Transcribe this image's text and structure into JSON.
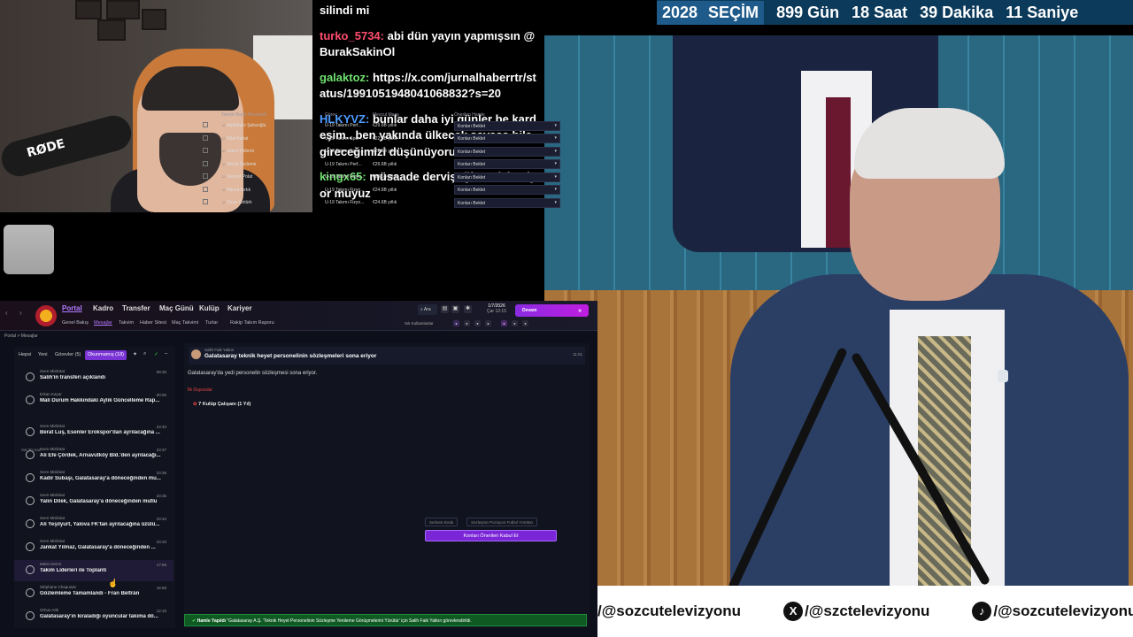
{
  "countdown": {
    "year": "2028",
    "label": "SEÇİM",
    "days": "899 Gün",
    "hours": "18 Saat",
    "minutes": "39 Dakika",
    "seconds": "11 Saniye"
  },
  "chat": [
    {
      "user": "",
      "color": "#ffffff",
      "text": "silindi mi"
    },
    {
      "user": "turko_5734:",
      "color": "#ff4d6d",
      "text": "abi dün yayın yapmışsın @BurakSakinOl"
    },
    {
      "user": "galaktoz:",
      "color": "#6fe06f",
      "text": "https://x.com/jurnalhaberrtr/status/1991051948041068832?s=20"
    },
    {
      "user": "HLKYVZ:",
      "color": "#4d9dff",
      "text": "bunlar daha iyi günler be kardeşim.. ben yakında ülkecek savaşa bile gireceğimizi düşünüyorum."
    },
    {
      "user": "kingx65:",
      "color": "#6fe06f",
      "text": "müsaade dervişoğlunu izlemiyor muyuz"
    }
  ],
  "webcam": {
    "mic_label": "RØDE"
  },
  "ticker": {
    "items": [
      "/@sozcutelevizyonu",
      "/@szctelevizyonu",
      "/@sozcutelevizyonu"
    ],
    "icons": [
      "X",
      "♪"
    ]
  },
  "game": {
    "nav": [
      "Portal",
      "Kadro",
      "Transfer",
      "Maç Günü",
      "Kulüp",
      "Kariyer"
    ],
    "subnav": [
      "Genel Bakış",
      "Mesajlar",
      "Takvim",
      "Haber Sitesi",
      "Maç Takvimi",
      "Turlar",
      "Rakip Takım Raporu"
    ],
    "search": "Ara",
    "date": "1/7/2026",
    "date_sub": "Çar 12:15",
    "continue": "Devam",
    "settings_label": "Sık Kullanılanlar",
    "breadcrumb": "Portal > Mesajlar",
    "filters": [
      "Hepsi",
      "Yeni",
      "Görevler (5)",
      "Okunmamış (18)"
    ],
    "messages": [
      {
        "from": "Sven Mislintat",
        "subject": "Salih'in transferi açıklandı",
        "time": "08:36"
      },
      {
        "from": "Erkan Kaçar",
        "subject": "Mali Durum Hakkındaki Aylık Güncelleme Rap...",
        "time": "00:00"
      },
      {
        "from": "Sven Mislintat",
        "subject": "Berat Luş, Esenler Erokspor'dan ayrılacağına ...",
        "time": "23:40"
      },
      {
        "from": "Sven Mislintat",
        "subject": "Ali Efe Çördek, Arnavutköy Bld.'den ayrılacağı...",
        "time": "23:37"
      },
      {
        "from": "Sven Mislintat",
        "subject": "Kadir Subaşı, Galatasaray'a döneceğinden mu...",
        "time": "23:35"
      },
      {
        "from": "Sven Mislintat",
        "subject": "Yalın Dilek, Galatasaray'a döneceğinden mutlu",
        "time": "23:35"
      },
      {
        "from": "Sven Mislintat",
        "subject": "Ali Yeşilyurt, Yalova FK'tan ayrılacağına üzülü...",
        "time": "23:34"
      },
      {
        "from": "Sven Mislintat",
        "subject": "Jankat Yılmaz, Galatasaray'a döneceğinden ...",
        "time": "23:33"
      },
      {
        "from": "Metin Demir",
        "subject": "Takım Liderleri ile Toplantı",
        "time": "17:59"
      },
      {
        "from": "Stéphane Chapuisat",
        "subject": "Gözlemleme Tamamlandı - Fran Beltrán",
        "time": "16:58"
      },
      {
        "from": "Orhun Atik",
        "subject": "Galatasaray'ın kiraladığı oyuncular takıma dö...",
        "time": "12:10"
      }
    ],
    "day_header": "Sal 30 Haz",
    "reader": {
      "from": "Salih Faik Yatkın",
      "title": "Galatasaray teknik heyet personelinin sözleşmeleri sona eriyor",
      "time": "11:01",
      "body": "Galatasaray'da yedi personelin sözleşmesi sona eriyor.",
      "section": "İlk Duyurular",
      "group": "7 Kulüp Çalışanı (1 Yıl)",
      "headers": [
        "Teknik Heyet Personeli",
        "Görev",
        "Mevcut Maaş",
        "Önerilen Hamle"
      ],
      "rows": [
        [
          "Abdülaziz Şahaoğlu",
          "U-19 Takımı Perf...",
          "€29.6B yıllık",
          "Konları Beklet"
        ],
        [
          "Bilal Kartal",
          "U-19 Takımı Spor ...",
          "€22.6B yıllık",
          "Konları Beklet"
        ],
        [
          "Gürol Yıldırım",
          "U-19 Takımı Spor ...",
          "€22.6B yıllık",
          "Konları Beklet"
        ],
        [
          "Murat Özdemir",
          "U-19 Takımı Perf...",
          "€29.6B yıllık",
          "Konları Beklet"
        ],
        [
          "Sertvet Polat",
          "U-19 Takımı Fizyo...",
          "€24.6B yıllık",
          "Konları Beklet"
        ],
        [
          "Mesut Kırtık",
          "U-19 Takımı Fizyo...",
          "€24.6B yıllık",
          "Konları Beklet"
        ],
        [
          "Ozan Öztürk",
          "U-19 Takımı Fizyo...",
          "€24.6B yıllık",
          "Konları Beklet"
        ]
      ],
      "btn_free": "Serbest Bırak",
      "btn_extend": "Sözleşme Pozisyon Futbol Yürütün",
      "btn_accept": "Konları Önerileri Kabul Et"
    },
    "notification": {
      "title": "Hamle Yapıldı",
      "text": "\"Galatasaray A.Ş. 'Teknik Heyet Personelinin Sözleşme Yenileme Görüşmelerini Yürütür' için Salih Faik Yatkın görevlendirildi."
    }
  }
}
